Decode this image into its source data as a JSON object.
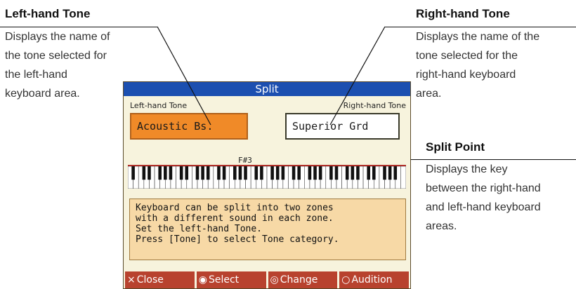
{
  "callouts": {
    "left_hand_tone": {
      "title": "Left-hand Tone",
      "lines": [
        "Displays the name of",
        "the tone selected for",
        "the left-hand",
        "keyboard area."
      ]
    },
    "right_hand_tone": {
      "title": "Right-hand Tone",
      "lines": [
        "Displays the name of the",
        "tone selected for the",
        "right-hand keyboard",
        "area."
      ]
    },
    "split_point": {
      "title": "Split Point",
      "lines": [
        "Displays the key",
        "between the right-hand",
        "and left-hand keyboard",
        "areas."
      ]
    }
  },
  "screen": {
    "title": "Split",
    "left_tone_label": "Left-hand Tone",
    "right_tone_label": "Right-hand Tone",
    "left_tone_value": "Acoustic Bs.",
    "right_tone_value": "Superior Grd",
    "split_point": "F#3",
    "message_lines": [
      "Keyboard can be split into two zones",
      "with a different sound in each zone.",
      "Set the left-hand Tone.",
      "Press [Tone] to select Tone category."
    ],
    "buttons": [
      {
        "icon": "close-x-icon",
        "glyph": "×",
        "label": "Close"
      },
      {
        "icon": "dial-left-right-icon",
        "glyph": "◉",
        "label": "Select"
      },
      {
        "icon": "dial-up-down-icon",
        "glyph": "◎",
        "label": "Change"
      },
      {
        "icon": "circle-icon",
        "glyph": "○",
        "label": "Audition"
      }
    ],
    "colors": {
      "title_bar": "#1c4fb0",
      "selected_tone": "#f08a28",
      "message_box": "#f7d9a6",
      "button": "#b8422e",
      "screen_bg": "#f7f3dd"
    }
  }
}
